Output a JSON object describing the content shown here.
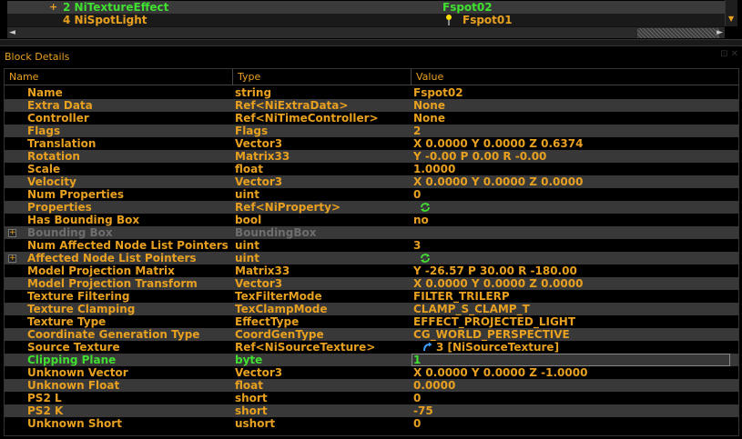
{
  "tree": {
    "rows": [
      {
        "expander": "+",
        "label": "2 NiTextureEffect",
        "value": "Fspot02"
      },
      {
        "expander": "",
        "label": "4 NiSpotLight",
        "value": "Fspot01"
      }
    ]
  },
  "details": {
    "title": "Block Details",
    "controls": "⊡ ✕"
  },
  "columns": {
    "name": "Name",
    "type": "Type",
    "value": "Value"
  },
  "rows": [
    {
      "name": "Name",
      "type": "string",
      "value": "Fspot02"
    },
    {
      "name": "Extra Data",
      "type": "Ref<NiExtraData>",
      "value": "None"
    },
    {
      "name": "Controller",
      "type": "Ref<NiTimeController>",
      "value": "None"
    },
    {
      "name": "Flags",
      "type": "Flags",
      "value": "2"
    },
    {
      "name": "Translation",
      "type": "Vector3",
      "value": "X 0.0000 Y 0.0000 Z 0.6374"
    },
    {
      "name": "Rotation",
      "type": "Matrix33",
      "value": "Y -0.00 P 0.00 R -0.00"
    },
    {
      "name": "Scale",
      "type": "float",
      "value": "1.0000"
    },
    {
      "name": "Velocity",
      "type": "Vector3",
      "value": "X 0.0000 Y 0.0000 Z 0.0000"
    },
    {
      "name": "Num Properties",
      "type": "uint",
      "value": "0"
    },
    {
      "name": "Properties",
      "type": "Ref<NiProperty>",
      "value": ""
    },
    {
      "name": "Has Bounding Box",
      "type": "bool",
      "value": "no"
    },
    {
      "name": "Bounding Box",
      "type": "BoundingBox",
      "value": ""
    },
    {
      "name": "Num Affected Node List Pointers",
      "type": "uint",
      "value": "3"
    },
    {
      "name": "Affected Node List Pointers",
      "type": "uint",
      "value": ""
    },
    {
      "name": "Model Projection Matrix",
      "type": "Matrix33",
      "value": "Y -26.57 P 30.00 R -180.00"
    },
    {
      "name": "Model Projection Transform",
      "type": "Vector3",
      "value": "X 0.0000 Y 0.0000 Z 0.0000"
    },
    {
      "name": "Texture Filtering",
      "type": "TexFilterMode",
      "value": "FILTER_TRILERP"
    },
    {
      "name": "Texture Clamping",
      "type": "TexClampMode",
      "value": "CLAMP_S_CLAMP_T"
    },
    {
      "name": "Texture Type",
      "type": "EffectType",
      "value": "EFFECT_PROJECTED_LIGHT"
    },
    {
      "name": "Coordinate Generation Type",
      "type": "CoordGenType",
      "value": "CG_WORLD_PERSPECTIVE"
    },
    {
      "name": "Source Texture",
      "type": "Ref<NiSourceTexture>",
      "value": "3 [NiSourceTexture]"
    },
    {
      "name": "Clipping Plane",
      "type": "byte",
      "value": "1"
    },
    {
      "name": "Unknown Vector",
      "type": "Vector3",
      "value": "X 0.0000 Y 0.0000 Z -1.0000"
    },
    {
      "name": "Unknown Float",
      "type": "float",
      "value": "0.0000"
    },
    {
      "name": "PS2 L",
      "type": "short",
      "value": "0"
    },
    {
      "name": "PS2 K",
      "type": "short",
      "value": "-75"
    },
    {
      "name": "Unknown Short",
      "type": "ushort",
      "value": "0"
    }
  ],
  "colors": {
    "accent": "#e8a020",
    "highlight": "#40e030",
    "disabled": "#6e6e6e",
    "stripe": "#383838"
  }
}
